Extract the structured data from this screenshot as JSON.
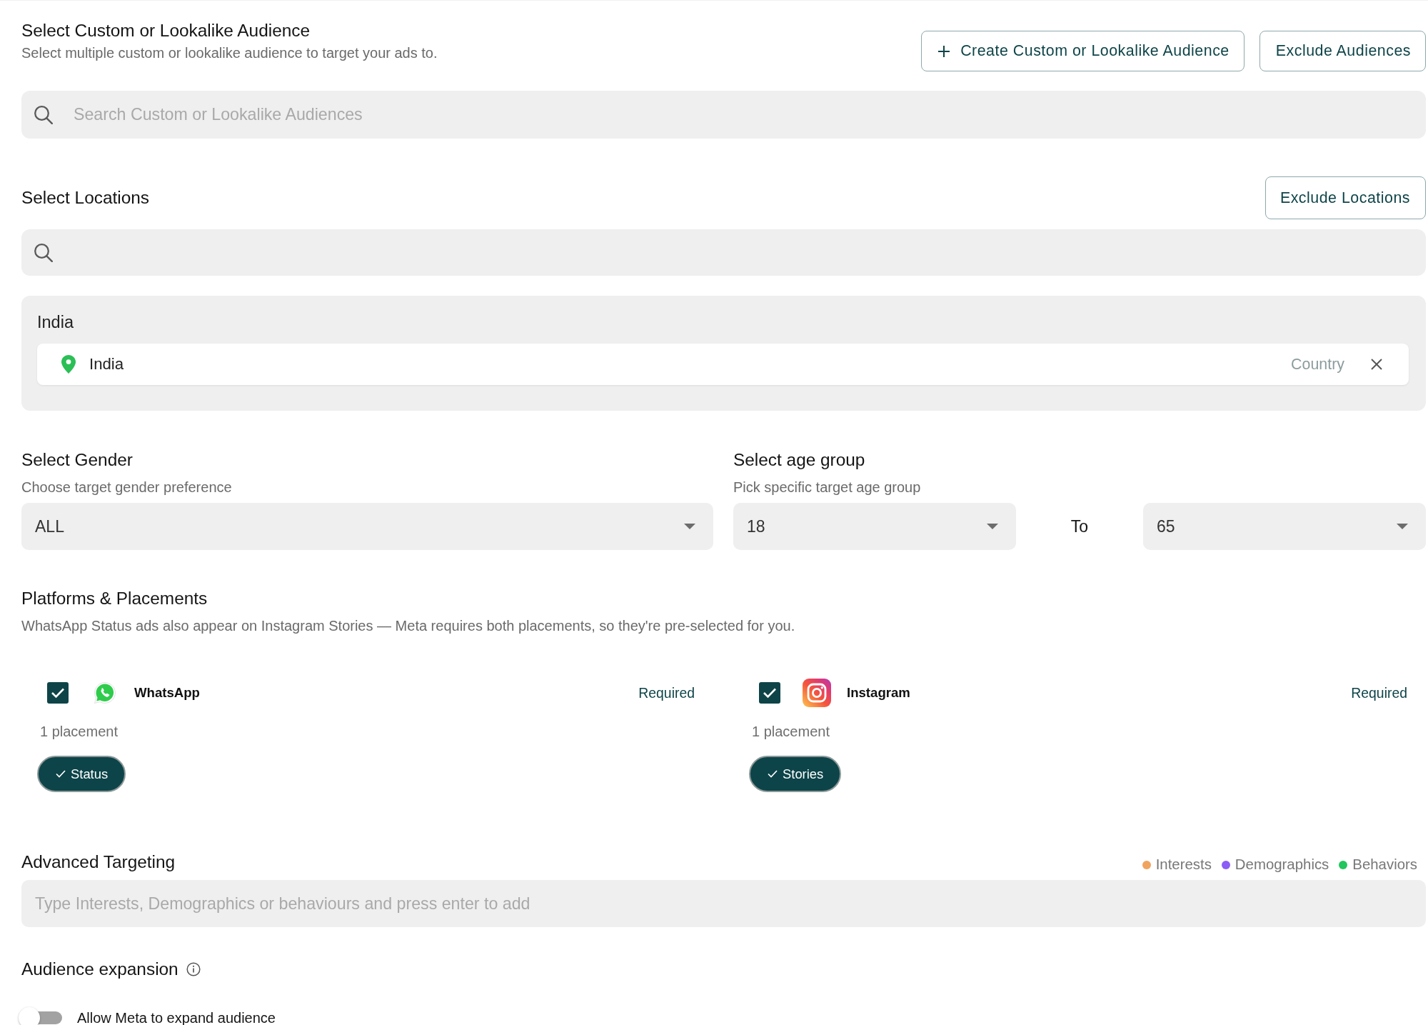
{
  "custom_audience": {
    "title": "Select Custom or Lookalike Audience",
    "subtitle": "Select multiple custom or lookalike audience to target your ads to.",
    "buttons": [
      {
        "kind": "create",
        "label": "Create Custom or Lookalike Audience"
      },
      {
        "kind": "plain",
        "label": "Exclude Audiences"
      }
    ],
    "search": {
      "placeholder": "Search Custom or Lookalike Audiences"
    }
  },
  "locations": {
    "title": "Select Locations",
    "button": {
      "label": "Exclude Locations"
    },
    "selected_groups": [
      {
        "title": "India",
        "items": [
          {
            "name": "India",
            "type": "Country"
          }
        ]
      }
    ]
  },
  "gender": {
    "title": "Select Gender",
    "subtitle": "Choose target gender preference",
    "value": "ALL"
  },
  "age_group": {
    "title": "Select age group",
    "subtitle": "Pick specific target age group",
    "from": "18",
    "separator": "To",
    "to": "65"
  },
  "platforms": {
    "title": "Platforms & Placements",
    "description": "WhatsApp Status ads also appear on Instagram Stories — Meta requires both placements, so they're pre-selected for you.",
    "items": [
      {
        "kind": "whatsapp",
        "name": "WhatsApp",
        "checked": true,
        "badge": "Required",
        "count": "1 placement",
        "placements": [
          {
            "label": "Status",
            "selected": true
          }
        ]
      },
      {
        "kind": "instagram",
        "name": "Instagram",
        "checked": true,
        "badge": "Required",
        "count": "1 placement",
        "placements": [
          {
            "label": "Stories",
            "selected": true
          }
        ]
      }
    ]
  },
  "advanced_targeting": {
    "title": "Advanced Targeting",
    "legend": [
      {
        "label": "Interests",
        "color": "#f0a35e"
      },
      {
        "label": "Demographics",
        "color": "#8b5cf6"
      },
      {
        "label": "Behaviors",
        "color": "#22c55e"
      }
    ],
    "input": {
      "placeholder": "Type Interests, Demographics or behaviours and press enter to add"
    }
  },
  "audience_expansion": {
    "title": "Audience expansion",
    "toggle": {
      "label": "Allow Meta to expand audience",
      "on": false
    }
  }
}
